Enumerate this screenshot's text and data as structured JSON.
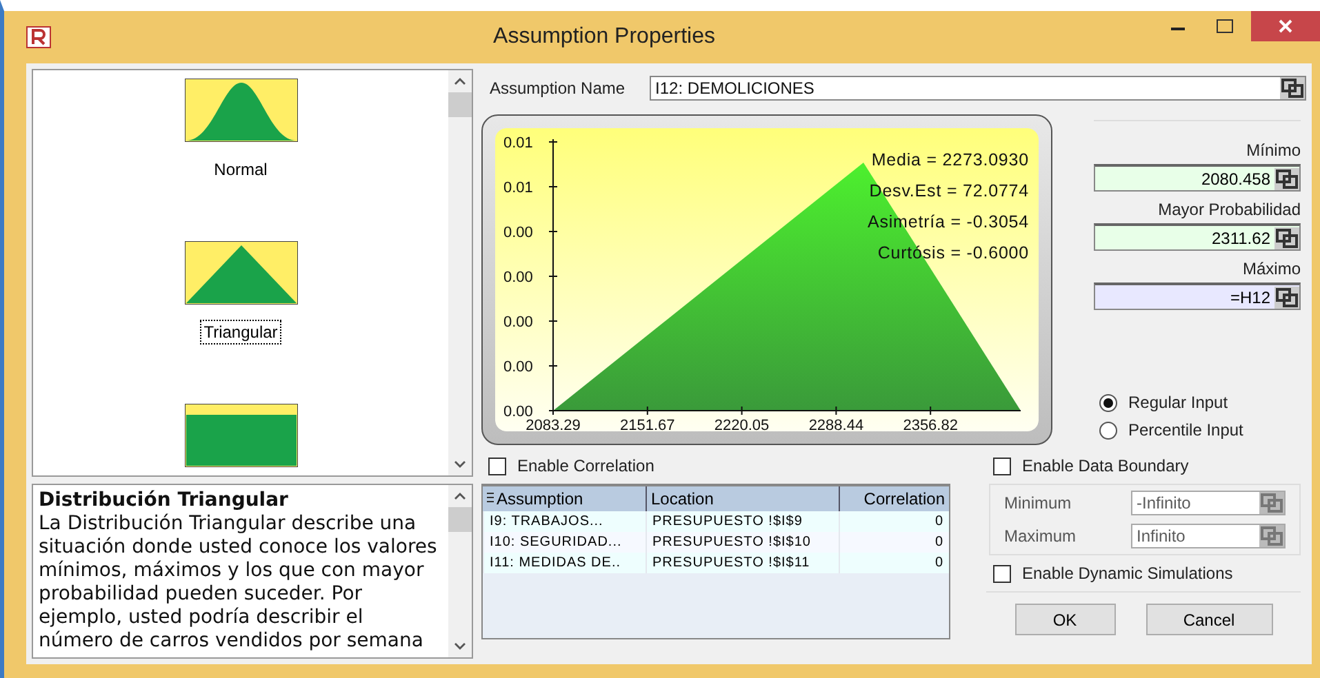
{
  "window": {
    "title": "Assumption Properties"
  },
  "gallery": {
    "items": [
      {
        "label": "Normal",
        "kind": "normal",
        "selected": false
      },
      {
        "label": "Triangular",
        "kind": "triangular",
        "selected": true
      },
      {
        "kind": "uniform"
      }
    ]
  },
  "description": {
    "title": "Distribución Triangular",
    "text": "La Distribución Triangular describe una situación donde usted conoce los valores mínimos, máximos y los que con mayor probabilidad pueden suceder. Por ejemplo, usted podría describir el número de carros vendidos por semana"
  },
  "assumption_name": {
    "label": "Assumption Name",
    "value": "I12: DEMOLICIONES"
  },
  "chart": {
    "y_tick_labels": [
      "0.01",
      "0.01",
      "0.00",
      "0.00",
      "0.00",
      "0.00",
      "0.00"
    ],
    "x_tick_labels": [
      "2083.29",
      "2151.67",
      "2220.05",
      "2288.44",
      "2356.82"
    ],
    "stats": [
      "Media = 2273.0930",
      "Desv.Est = 72.0774",
      "Asimetría = -0.3054",
      "Curtósis = -0.6000"
    ]
  },
  "parameters": [
    {
      "label": "Mínimo",
      "value": "2080.458",
      "kind": "value"
    },
    {
      "label": "Mayor Probabilidad",
      "value": "2311.62",
      "kind": "value"
    },
    {
      "label": "Máximo",
      "value": "=H12",
      "kind": "formula"
    }
  ],
  "input_mode": [
    {
      "label": "Regular Input",
      "selected": true
    },
    {
      "label": "Percentile Input",
      "selected": false
    }
  ],
  "enable_correlation": {
    "label": "Enable Correlation",
    "checked": false
  },
  "correlation_table": {
    "columns": [
      "Assumption",
      "Location",
      "Correlation"
    ],
    "rows": [
      [
        "I9: TRABAJOS...",
        "PRESUPUESTO !$I$9",
        "0"
      ],
      [
        "I10: SEGURIDAD...",
        "PRESUPUESTO !$I$10",
        "0"
      ],
      [
        "I11: MEDIDAS DE..",
        "PRESUPUESTO !$I$11",
        "0"
      ]
    ]
  },
  "enable_data_boundary": {
    "label": "Enable Data Boundary",
    "checked": false
  },
  "boundary": [
    {
      "label": "Minimum",
      "value": "-Infinito",
      "disabled": true
    },
    {
      "label": "Maximum",
      "value": "Infinito",
      "disabled": true
    }
  ],
  "enable_dynamic_simulations": {
    "label": "Enable Dynamic Simulations",
    "checked": false
  },
  "buttons": [
    "OK",
    "Cancel"
  ]
}
